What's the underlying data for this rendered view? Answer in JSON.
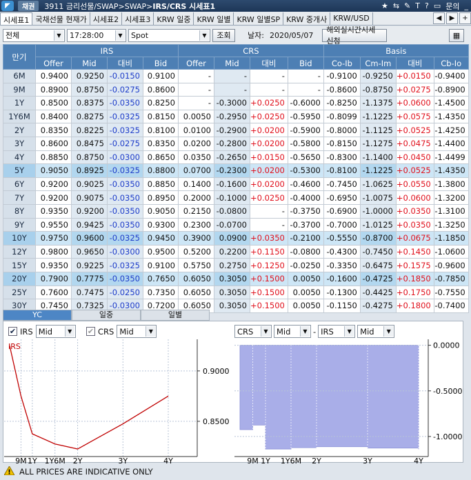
{
  "window": {
    "section": "채권",
    "screen_id": "3911",
    "path": "금리선물/SWAP>SWAP>",
    "title": "IRS/CRS 시세표1",
    "help": "문의"
  },
  "tabs": [
    "시세표1",
    "국채선물 현재가",
    "시세표2",
    "시세표3",
    "KRW 일중",
    "KRW 일별",
    "KRW 일별SP",
    "KRW 중개사",
    "KRW/USD"
  ],
  "toolbar": {
    "filter": "전체",
    "time": "17:28:00",
    "type": "Spot",
    "lookup": "조회",
    "date_label": "날자:",
    "date": "2020/05/07",
    "overseas_btn": "해외실시간시세 신청"
  },
  "table": {
    "group_headers": [
      "만기",
      "IRS",
      "CRS",
      "Basis"
    ],
    "columns": [
      "Offer",
      "Mid",
      "대비",
      "Bid",
      "Offer",
      "Mid",
      "대비",
      "Bid",
      "Co-Ib",
      "Cm-Im",
      "대비",
      "Cb-Io"
    ],
    "rows": [
      [
        "6M",
        "0.9400",
        "0.9250",
        "-0.0150",
        "0.9100",
        "-",
        "-",
        "-",
        "-",
        "-0.9100",
        "-0.9250",
        "+0.0150",
        "-0.9400"
      ],
      [
        "9M",
        "0.8900",
        "0.8750",
        "-0.0275",
        "0.8600",
        "-",
        "-",
        "-",
        "-",
        "-0.8600",
        "-0.8750",
        "+0.0275",
        "-0.8900"
      ],
      [
        "1Y",
        "0.8500",
        "0.8375",
        "-0.0350",
        "0.8250",
        "-",
        "-0.3000",
        "+0.0250",
        "-0.6000",
        "-0.8250",
        "-1.1375",
        "+0.0600",
        "-1.4500"
      ],
      [
        "1Y6M",
        "0.8400",
        "0.8275",
        "-0.0325",
        "0.8150",
        "0.0050",
        "-0.2950",
        "+0.0250",
        "-0.5950",
        "-0.8099",
        "-1.1225",
        "+0.0575",
        "-1.4350"
      ],
      [
        "2Y",
        "0.8350",
        "0.8225",
        "-0.0325",
        "0.8100",
        "0.0100",
        "-0.2900",
        "+0.0200",
        "-0.5900",
        "-0.8000",
        "-1.1125",
        "+0.0525",
        "-1.4250"
      ],
      [
        "3Y",
        "0.8600",
        "0.8475",
        "-0.0275",
        "0.8350",
        "0.0200",
        "-0.2800",
        "+0.0200",
        "-0.5800",
        "-0.8150",
        "-1.1275",
        "+0.0475",
        "-1.4400"
      ],
      [
        "4Y",
        "0.8850",
        "0.8750",
        "-0.0300",
        "0.8650",
        "0.0350",
        "-0.2650",
        "+0.0150",
        "-0.5650",
        "-0.8300",
        "-1.1400",
        "+0.0450",
        "-1.4499"
      ],
      [
        "5Y",
        "0.9050",
        "0.8925",
        "-0.0325",
        "0.8800",
        "0.0700",
        "-0.2300",
        "+0.0200",
        "-0.5300",
        "-0.8100",
        "-1.1225",
        "+0.0525",
        "-1.4350"
      ],
      [
        "6Y",
        "0.9200",
        "0.9025",
        "-0.0350",
        "0.8850",
        "0.1400",
        "-0.1600",
        "+0.0200",
        "-0.4600",
        "-0.7450",
        "-1.0625",
        "+0.0550",
        "-1.3800"
      ],
      [
        "7Y",
        "0.9200",
        "0.9075",
        "-0.0350",
        "0.8950",
        "0.2000",
        "-0.1000",
        "+0.0250",
        "-0.4000",
        "-0.6950",
        "-1.0075",
        "+0.0600",
        "-1.3200"
      ],
      [
        "8Y",
        "0.9350",
        "0.9200",
        "-0.0350",
        "0.9050",
        "0.2150",
        "-0.0800",
        "-",
        "-0.3750",
        "-0.6900",
        "-1.0000",
        "+0.0350",
        "-1.3100"
      ],
      [
        "9Y",
        "0.9550",
        "0.9425",
        "-0.0350",
        "0.9300",
        "0.2300",
        "-0.0700",
        "-",
        "-0.3700",
        "-0.7000",
        "-1.0125",
        "+0.0350",
        "-1.3250"
      ],
      [
        "10Y",
        "0.9750",
        "0.9600",
        "-0.0325",
        "0.9450",
        "0.3900",
        "0.0900",
        "+0.0350",
        "-0.2100",
        "-0.5550",
        "-0.8700",
        "+0.0675",
        "-1.1850"
      ],
      [
        "12Y",
        "0.9800",
        "0.9650",
        "-0.0300",
        "0.9500",
        "0.5200",
        "0.2200",
        "+0.1150",
        "-0.0800",
        "-0.4300",
        "-0.7450",
        "+0.1450",
        "-1.0600"
      ],
      [
        "15Y",
        "0.9350",
        "0.9225",
        "-0.0325",
        "0.9100",
        "0.5750",
        "0.2750",
        "+0.1250",
        "-0.0250",
        "-0.3350",
        "-0.6475",
        "+0.1575",
        "-0.9600"
      ],
      [
        "20Y",
        "0.7900",
        "0.7775",
        "-0.0350",
        "0.7650",
        "0.6050",
        "0.3050",
        "+0.1500",
        "0.0050",
        "-0.1600",
        "-0.4725",
        "+0.1850",
        "-0.7850"
      ],
      [
        "25Y",
        "0.7600",
        "0.7475",
        "-0.0250",
        "0.7350",
        "0.6050",
        "0.3050",
        "+0.1500",
        "0.0050",
        "-0.1300",
        "-0.4425",
        "+0.1750",
        "-0.7550"
      ],
      [
        "30Y",
        "0.7450",
        "0.7325",
        "-0.0300",
        "0.7200",
        "0.6050",
        "0.3050",
        "+0.1500",
        "0.0050",
        "-0.1150",
        "-0.4275",
        "+0.1800",
        "-0.7400"
      ]
    ]
  },
  "subtabs": [
    "YC",
    "일중",
    "일별"
  ],
  "left_panel": {
    "irs_label": "IRS",
    "irs_sel": "Mid",
    "crs_label": "CRS",
    "crs_sel": "Mid",
    "irs_checked": true,
    "crs_checked": true
  },
  "right_panel": {
    "left_a": "CRS",
    "left_b": "Mid",
    "dash": "-",
    "right_a": "IRS",
    "right_b": "Mid"
  },
  "footer": {
    "notice": "ALL PRICES ARE INDICATIVE ONLY"
  },
  "chart_data": [
    {
      "type": "line",
      "series": [
        {
          "name": "IRS",
          "x": [
            "6M",
            "9M",
            "1Y",
            "1Y6M",
            "2Y",
            "3Y",
            "4Y"
          ],
          "values": [
            0.925,
            0.875,
            0.8375,
            0.8275,
            0.8225,
            0.8475,
            0.875
          ]
        }
      ],
      "x_ticks": [
        "9M",
        "1Y",
        "1Y6M",
        "2Y",
        "3Y",
        "4Y"
      ],
      "y_ticks": [
        "0.9000",
        "0.8500"
      ],
      "series_label": "IRS",
      "color": "#c00000",
      "grid": true
    },
    {
      "type": "area",
      "x": [
        "6M",
        "9M",
        "1Y",
        "1Y6M",
        "2Y",
        "3Y",
        "4Y"
      ],
      "values": [
        -0.925,
        -0.875,
        -1.1375,
        -1.1225,
        -1.1125,
        -1.1275,
        -1.14
      ],
      "x_ticks": [
        "9M",
        "1Y",
        "1Y6M",
        "2Y",
        "3Y",
        "4Y"
      ],
      "y_ticks": [
        "0.0000",
        "-0.5000",
        "-1.0000"
      ],
      "color": "#a9aee8",
      "grid": true
    }
  ]
}
